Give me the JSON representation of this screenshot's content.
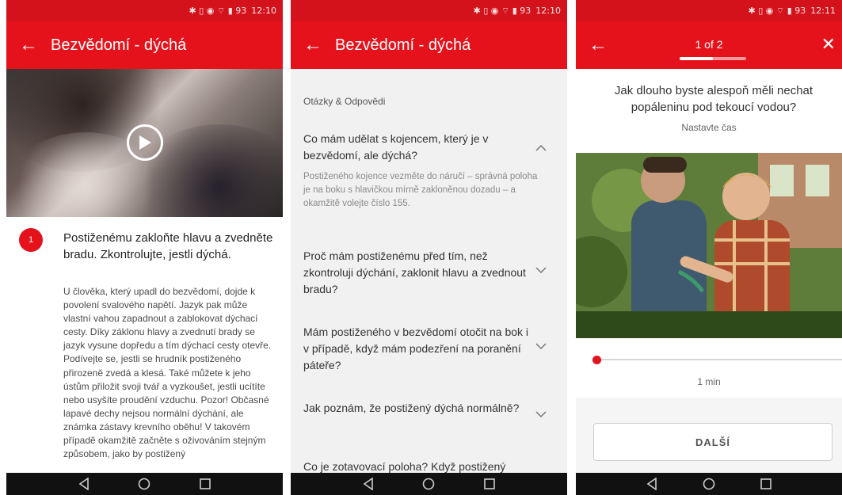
{
  "status": {
    "time_a": "12:10",
    "time_b": "12:10",
    "time_c": "12:11",
    "icons": "✱ ▯ ◉ ⌔ ▮ 93"
  },
  "screen1": {
    "title": "Bezvědomí - dýchá",
    "step_number": "1",
    "step_title": "Postiženému zakloňte hlavu a zvedněte bradu. Zkontrolujte, jestli dýchá.",
    "step_body": "U člověka, který upadl do bezvědomí, dojde k povolení svalového napětí. Jazyk pak může vlastní vahou zapadnout a zablokovat dýchací cesty. Díky záklonu hlavy a zvednutí brady se jazyk vysune dopředu a tím dýchací cesty otevře. Podívejte se, jestli se hrudník postiženého přirozeně zvedá a klesá. Také můžete k jeho ústům přiložit svoji tvář a vyzkoušet, jestli ucítíte nebo usyšíte proudění vzduchu. Pozor! Občasné lapavé dechy nejsou normální dýchání, ale známka zástavy krevního oběhu! V takovém případě okamžitě začněte s oživováním stejným způsobem, jako by postižený"
  },
  "screen2": {
    "title": "Bezvědomí - dýchá",
    "section": "Otázky & Odpovědi",
    "questions": [
      "Co mám udělat s kojencem, který je v bezvědomí, ale dýchá?",
      "Proč mám postiženému před tím, než zkontroluji dýchání, zaklonit hlavu a zvednout bradu?",
      "Mám postiženého v bezvědomí otočit na bok i v případě, když mám podezření na poranění páteře?",
      "Jak poznám, že postižený dýchá normálně?",
      "Co je zotavovací poloha? Když postižený"
    ],
    "answer_0": "Postiženého kojence vezměte do náručí – správná poloha je na boku s hlavičkou mírně zakloněnou dozadu – a okamžitě volejte číslo 155."
  },
  "screen3": {
    "counter": "1 of 2",
    "progress": 0.5,
    "close": "✕",
    "question": "Jak dlouho byste alespoň měli nechat popáleninu pod tekoucí vodou?",
    "hint": "Nastavte čas",
    "slider_value": "1 min",
    "next_label": "DALŠÍ"
  },
  "colors": {
    "brand_red": "#e5121c",
    "status_red": "#d4121c"
  }
}
